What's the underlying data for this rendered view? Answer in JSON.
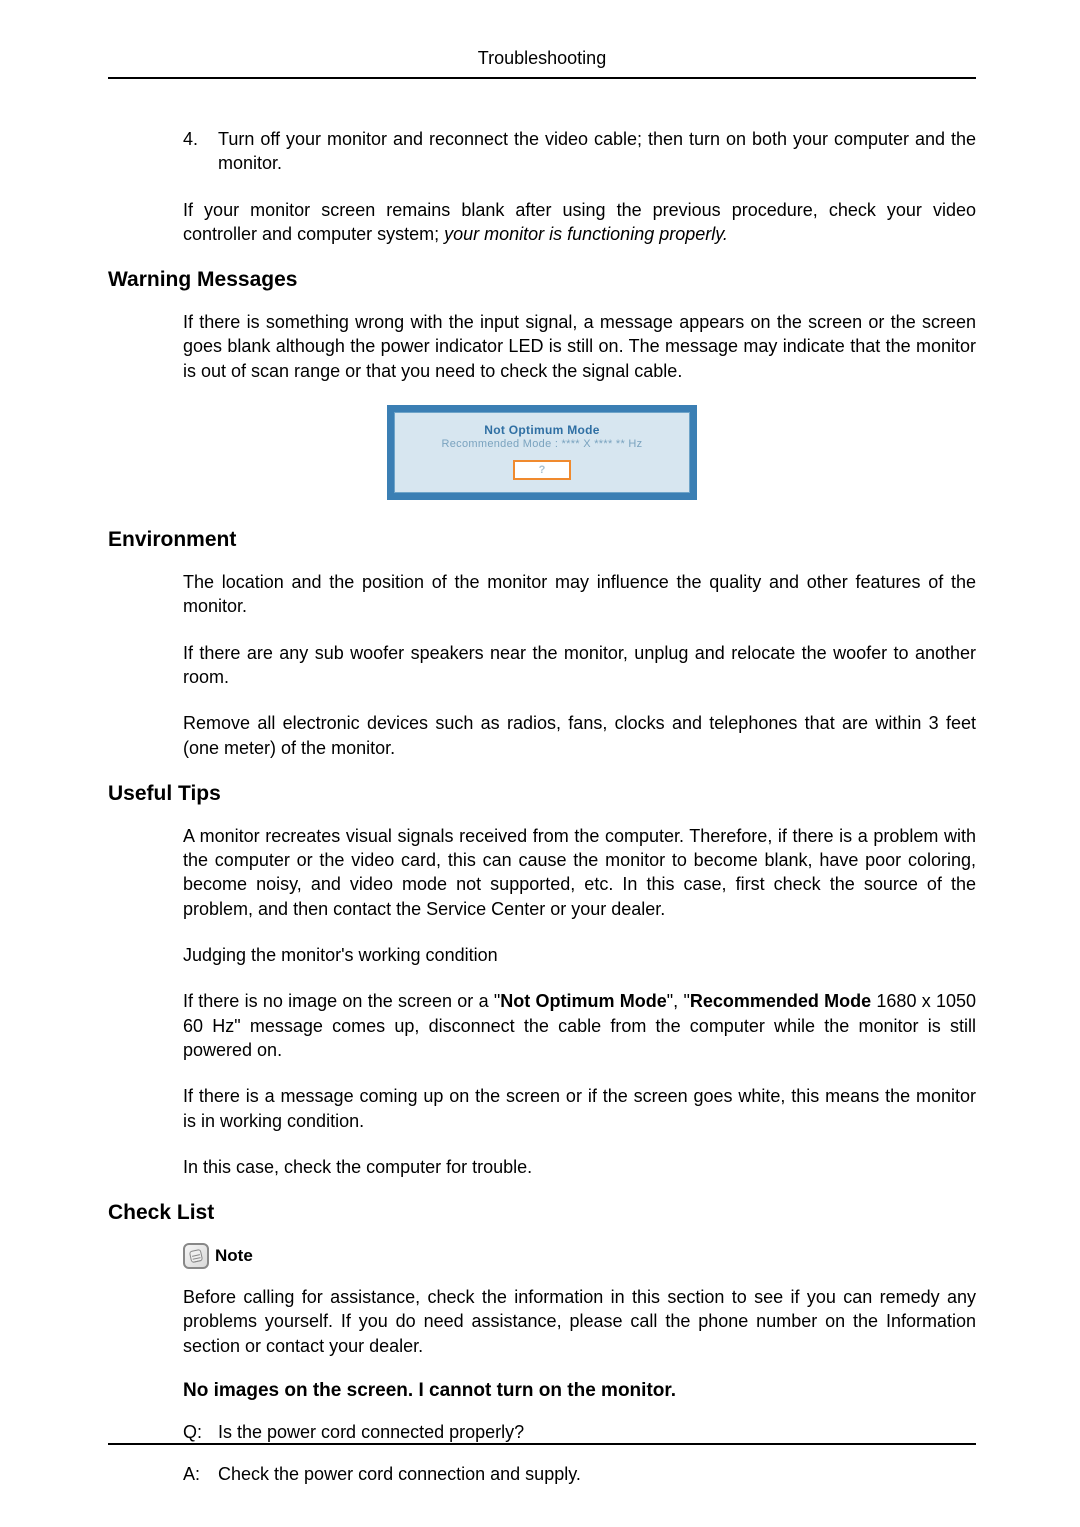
{
  "header": {
    "title": "Troubleshooting"
  },
  "step4": {
    "num": "4.",
    "text": "Turn off your monitor and reconnect the video cable; then turn on both your computer and the monitor."
  },
  "after_step_para": {
    "plain": "If your monitor screen remains blank after using the previous procedure, check your video controller and computer system; ",
    "italic": "your monitor is functioning properly."
  },
  "warning": {
    "heading": "Warning Messages",
    "para": "If there is something wrong with the input signal, a message appears on the screen or the screen goes blank although the power indicator LED is still on. The message may indicate that the monitor is out of scan range or that you need to check the signal cable.",
    "dialog": {
      "line1": "Not Optimum Mode",
      "line2": "Recommended Mode : **** X **** ** Hz",
      "button": "?"
    }
  },
  "environment": {
    "heading": "Environment",
    "p1": "The location and the position of the monitor may influence the quality and other features of the monitor.",
    "p2": "If there are any sub woofer speakers near the monitor, unplug and relocate the woofer to another room.",
    "p3": "Remove all electronic devices such as radios, fans, clocks and telephones that are within 3 feet (one meter) of the monitor."
  },
  "tips": {
    "heading": "Useful Tips",
    "p1": "A monitor recreates visual signals received from the computer. Therefore, if there is a problem with the computer or the video card, this can cause the monitor to become blank, have poor coloring, become noisy, and video mode not supported, etc. In this case, first check the source of the problem, and then contact the Service Center or your dealer.",
    "p2": "Judging the monitor's working condition",
    "p3_pre": "If there is no image on the screen or a \"",
    "p3_b1": "Not Optimum Mode",
    "p3_mid": "\", \"",
    "p3_b2": "Recommended Mode",
    "p3_post": " 1680 x 1050 60 Hz\" message comes up, disconnect the cable from the computer while the monitor is still powered on.",
    "p4": "If there is a message coming up on the screen or if the screen goes white, this means the monitor is in working condition.",
    "p5": "In this case, check the computer for trouble."
  },
  "checklist": {
    "heading": "Check List",
    "note_label": "Note",
    "note_para": "Before calling for assistance, check the information in this section to see if you can remedy any problems yourself. If you do need assistance, please call the phone number on the Information section or contact your dealer.",
    "sub_heading": "No images on the screen. I cannot turn on the monitor.",
    "q_label": "Q:",
    "q_text": "Is the power cord connected properly?",
    "a_label": "A:",
    "a_text": "Check the power cord connection and supply."
  }
}
